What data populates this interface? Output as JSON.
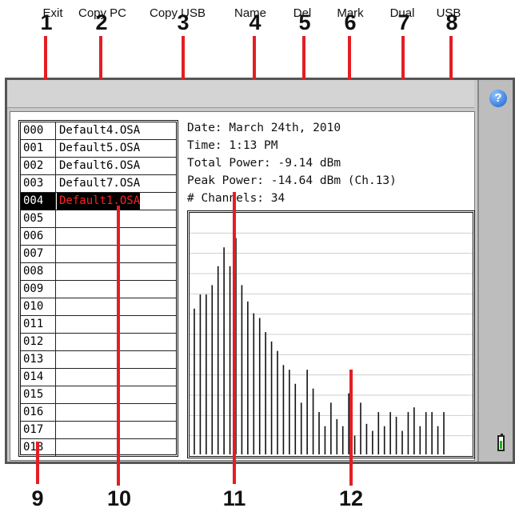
{
  "callouts_top": [
    "1",
    "2",
    "3",
    "4",
    "5",
    "6",
    "7",
    "8"
  ],
  "callouts_bottom": [
    "9",
    "10",
    "11",
    "12"
  ],
  "menu": {
    "items": [
      {
        "label": "Exit"
      },
      {
        "label": "Copy PC"
      },
      {
        "label": "Copy USB"
      },
      {
        "label": "Name"
      },
      {
        "label": "Del"
      },
      {
        "label": "Mark"
      },
      {
        "label": "Dual"
      },
      {
        "label": "USB"
      }
    ]
  },
  "side": {
    "help_icon": "?",
    "battery_icon": "battery-icon"
  },
  "files": [
    {
      "num": "000",
      "name": "Default4.OSA"
    },
    {
      "num": "001",
      "name": "Default5.OSA"
    },
    {
      "num": "002",
      "name": "Default6.OSA"
    },
    {
      "num": "003",
      "name": "Default7.OSA"
    },
    {
      "num": "004",
      "name": "Default1.OSA",
      "selected": true
    },
    {
      "num": "005",
      "name": ""
    },
    {
      "num": "006",
      "name": ""
    },
    {
      "num": "007",
      "name": ""
    },
    {
      "num": "008",
      "name": ""
    },
    {
      "num": "009",
      "name": ""
    },
    {
      "num": "010",
      "name": ""
    },
    {
      "num": "011",
      "name": ""
    },
    {
      "num": "012",
      "name": ""
    },
    {
      "num": "013",
      "name": ""
    },
    {
      "num": "014",
      "name": ""
    },
    {
      "num": "015",
      "name": ""
    },
    {
      "num": "016",
      "name": ""
    },
    {
      "num": "017",
      "name": ""
    },
    {
      "num": "018",
      "name": ""
    }
  ],
  "info": {
    "date": "Date: March 24th, 2010",
    "time": "Time: 1:13 PM",
    "total_power": "Total Power: -9.14 dBm",
    "peak_power": "Peak Power: -14.64 dBm (Ch.13)",
    "channels": "# Channels: 34"
  },
  "colors": {
    "callout_line": "#e31e24",
    "selected_text": "#ff2020",
    "selected_bg": "#000000"
  },
  "chart_data": {
    "type": "bar",
    "grid": true,
    "ylim": [
      0,
      1
    ],
    "values": [
      0.62,
      0.68,
      0.68,
      0.72,
      0.8,
      0.88,
      0.8,
      0.92,
      0.72,
      0.65,
      0.6,
      0.58,
      0.52,
      0.48,
      0.44,
      0.38,
      0.36,
      0.3,
      0.22,
      0.36,
      0.28,
      0.18,
      0.12,
      0.22,
      0.15,
      0.12,
      0.26,
      0.08,
      0.22,
      0.13,
      0.1,
      0.18,
      0.12,
      0.18,
      0.16,
      0.1,
      0.18,
      0.2,
      0.12,
      0.18,
      0.18,
      0.12,
      0.18
    ]
  }
}
